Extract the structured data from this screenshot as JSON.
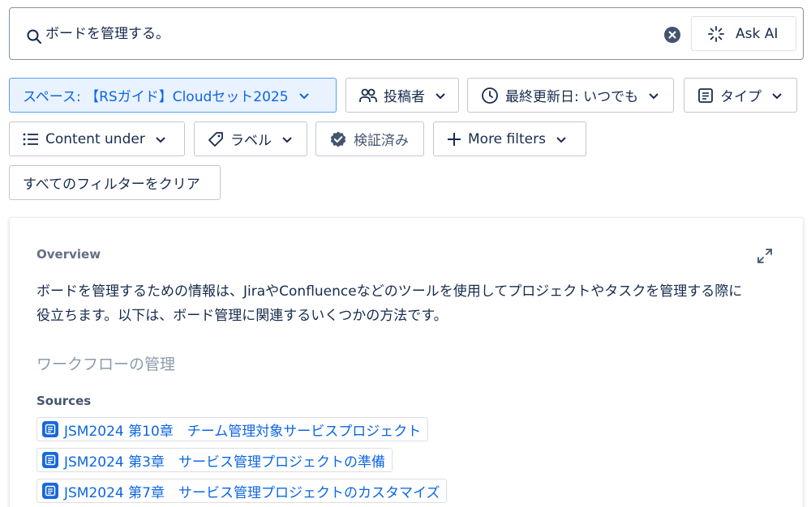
{
  "search": {
    "query": "ボードを管理する。",
    "ask_ai_label": "Ask AI"
  },
  "filters": {
    "space": "スペース: 【RSガイド】Cloudセット2025",
    "contributor": "投稿者",
    "last_updated": "最終更新日: いつでも",
    "type": "タイプ",
    "content_under": "Content under",
    "label": "ラベル",
    "verified": "検証済み",
    "more_filters": "More filters",
    "clear_all": "すべてのフィルターをクリア"
  },
  "overview": {
    "label": "Overview",
    "summary_line1": "ボードを管理するための情報は、JiraやConfluenceなどのツールを使用してプロジェクトやタスクを管理する際に",
    "summary_line2": "役立ちます。以下は、ボード管理に関連するいくつかの方法です。",
    "section_heading": "ワークフローの管理",
    "sources_label": "Sources",
    "sources": [
      "JSM2024 第10章　チーム管理対象サービスプロジェクト",
      "JSM2024 第3章　サービス管理プロジェクトの準備",
      "JSM2024 第7章　サービス管理プロジェクトのカスタマイズ"
    ]
  },
  "colors": {
    "accent": "#0c66e4",
    "selected_bg": "#e9f2ff",
    "text": "#172b4d",
    "muted": "#626f86"
  }
}
